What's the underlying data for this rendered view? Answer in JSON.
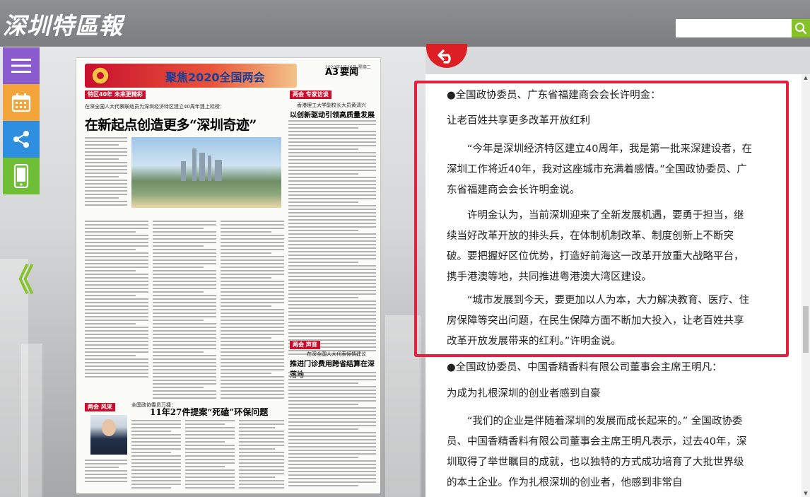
{
  "header": {
    "logo_text": "深圳特區報",
    "search_placeholder": "",
    "search_icon": "search-icon"
  },
  "tools": {
    "menu_icon": "menu-icon",
    "calendar_icon": "calendar-icon",
    "share_icon": "share-icon",
    "phone_icon": "phone-icon",
    "prev_page": "《"
  },
  "newspaper": {
    "banner": "聚焦2020全国两会",
    "page_label": "A3",
    "section": "要闻",
    "date_line": "2020年5月26日 星期二",
    "tag_left": "特区40年 未来更精彩",
    "subhead": "在深全国人大代表联络员为深圳经济特区建立40周年建上标榜：",
    "headline": "在新起点创造更多“深圳奇迹”",
    "tag_right": "两会 专家访谈",
    "right_sub": "香港理工大学副校长大员黄清兴",
    "right_headline": "以创新驱动引领高质量发展",
    "tag_bottom_left": "两会 风采",
    "bottom_sub": "全国政协委员万捷：",
    "bottom_headline": "11年27件提案“死磕”环保问题",
    "tag_bottom_right": "两会 声音",
    "bottom_right_sub": "在深全国人大代表倾情建议",
    "bottom_right_headline": "推进门诊费用跨省结算在深落地"
  },
  "reader": {
    "paragraphs": [
      "●全国政协委员、广东省福建商会会长许明金：",
      "让老百姓共享更多改革开放红利",
      "“今年是深圳经济特区建立40周年，我是第一批来深建设者，在深圳工作将近40年，我对这座城市充满着感情。”全国政协委员、广东省福建商会会长许明金说。",
      "许明金认为，当前深圳迎来了全新发展机遇，要勇于担当，继续当好改革开放的排头兵，在体制机制改革、制度创新上不断突破。要把握好区位优势，打造好前海这一改革开放重大战略平台，携手港澳等地，共同推进粤港澳大湾区建设。",
      "“城市发展到今天，要更加以人为本，大力解决教育、医疗、住房保障等突出问题，在民生保障方面不断加大投入，让老百姓共享改革开放发展带来的红利。”许明金说。",
      "●全国政协委员、中国香精香料有限公司董事会主席王明凡：",
      "为成为扎根深圳的创业者感到自豪",
      "“我们的企业是伴随着深圳的发展而成长起来的。” 全国政协委员、中国香精香料有限公司董事会主席王明凡表示，过去40年，深圳取得了举世瞩目的成就，也以独特的方式成功培育了大批世界级的本土企业。作为扎根深圳的创业者，他感到非常自"
    ]
  },
  "colors": {
    "header_bg": "#868789",
    "highlight_border": "#e3203e",
    "back_button": "#dc1f25",
    "search_button": "#84c227"
  }
}
